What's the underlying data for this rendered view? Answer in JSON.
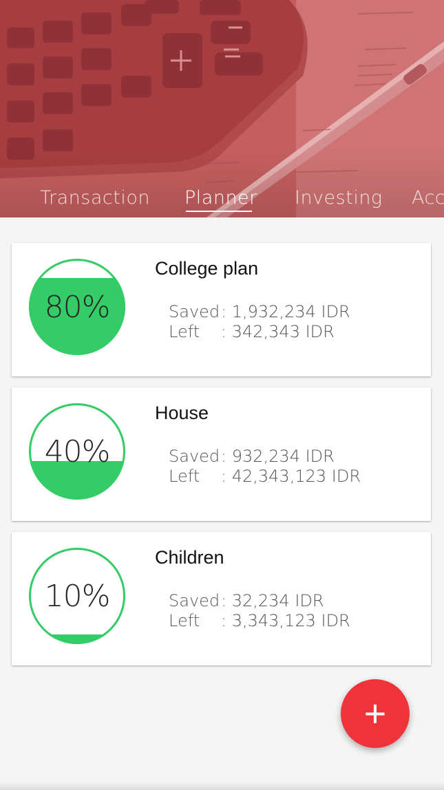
{
  "header": {
    "tabs": [
      {
        "label": "Transaction",
        "active": false
      },
      {
        "label": "Planner",
        "active": true
      },
      {
        "label": "Investing",
        "active": false
      },
      {
        "label": "Acc",
        "active": false
      }
    ],
    "background_tint": "#c0595a"
  },
  "plans": [
    {
      "title": "College plan",
      "percent": "80%",
      "fill_fraction": 0.8,
      "saved_label": "Saved",
      "saved_value": ": 1,932,234 IDR",
      "left_label": "Left",
      "left_value": ": 342,343 IDR"
    },
    {
      "title": "House",
      "percent": "40%",
      "fill_fraction": 0.4,
      "saved_label": "Saved",
      "saved_value": ": 932,234 IDR",
      "left_label": "Left",
      "left_value": ": 42,343,123 IDR"
    },
    {
      "title": "Children",
      "percent": "10%",
      "fill_fraction": 0.1,
      "saved_label": "Saved",
      "saved_value": ": 32,234 IDR",
      "left_label": "Left",
      "left_value": ": 3,343,123 IDR"
    }
  ],
  "fab": {
    "label": "+",
    "color": "#f0333b"
  },
  "colors": {
    "gauge_green": "#33cc66",
    "accent_red": "#f0333b"
  }
}
